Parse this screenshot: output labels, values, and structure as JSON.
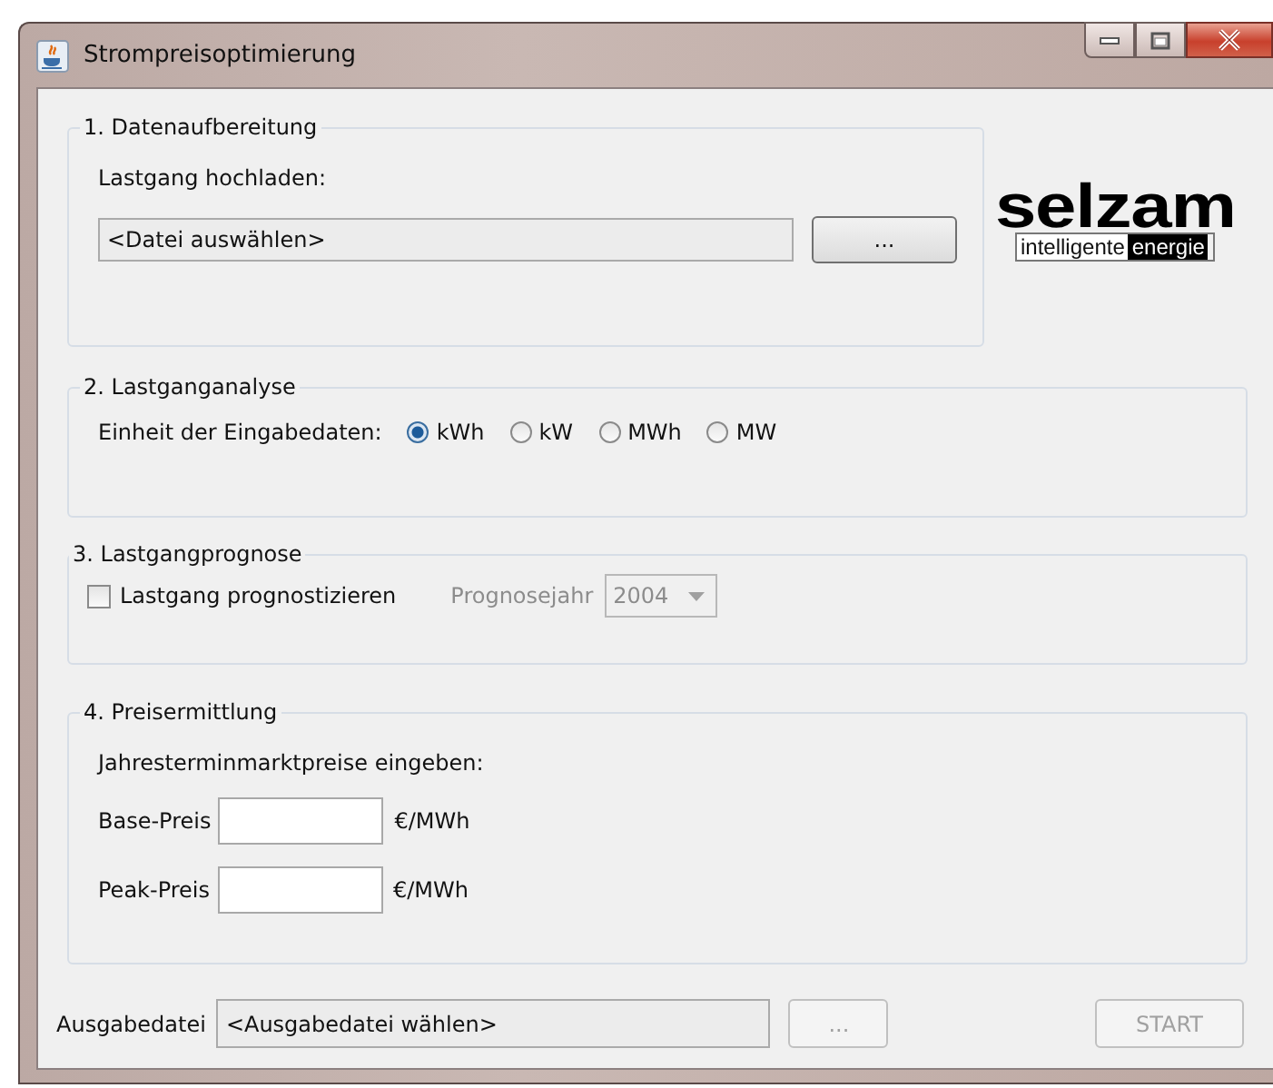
{
  "window": {
    "title": "Strompreisoptimierung"
  },
  "datenaufbereitung": {
    "title": "1. Datenaufbereitung",
    "label": "Lastgang hochladen:",
    "file_value": "<Datei auswählen>",
    "browse_button": "..."
  },
  "logo": {
    "brand": "selzam",
    "tagline_left": "intelligente",
    "tagline_right": "energie"
  },
  "lastganganalyse": {
    "title": "2. Lastganganalyse",
    "label": "Einheit der Eingabedaten:",
    "units": [
      {
        "label": "kWh",
        "selected": true
      },
      {
        "label": "kW",
        "selected": false
      },
      {
        "label": "MWh",
        "selected": false
      },
      {
        "label": "MW",
        "selected": false
      }
    ]
  },
  "lastgangprognose": {
    "title": "3. Lastgangprognose",
    "checkbox": {
      "label": "Lastgang prognostizieren",
      "checked": false
    },
    "year_label": "Prognosejahr",
    "year_value": "2004",
    "year_disabled": true
  },
  "preisermittlung": {
    "title": "4. Preisermittlung",
    "label": "Jahresterminmarktpreise eingeben:",
    "prices": [
      {
        "label": "Base-Preis",
        "unit": "€/MWh"
      },
      {
        "label": "Peak-Preis",
        "unit": "€/MWh"
      }
    ]
  },
  "output": {
    "label": "Ausgabedatei",
    "file_value": "<Ausgabedatei wählen>",
    "browse_button": {
      "label": "...",
      "disabled": true
    },
    "start_button": {
      "label": "START",
      "disabled": true
    }
  }
}
